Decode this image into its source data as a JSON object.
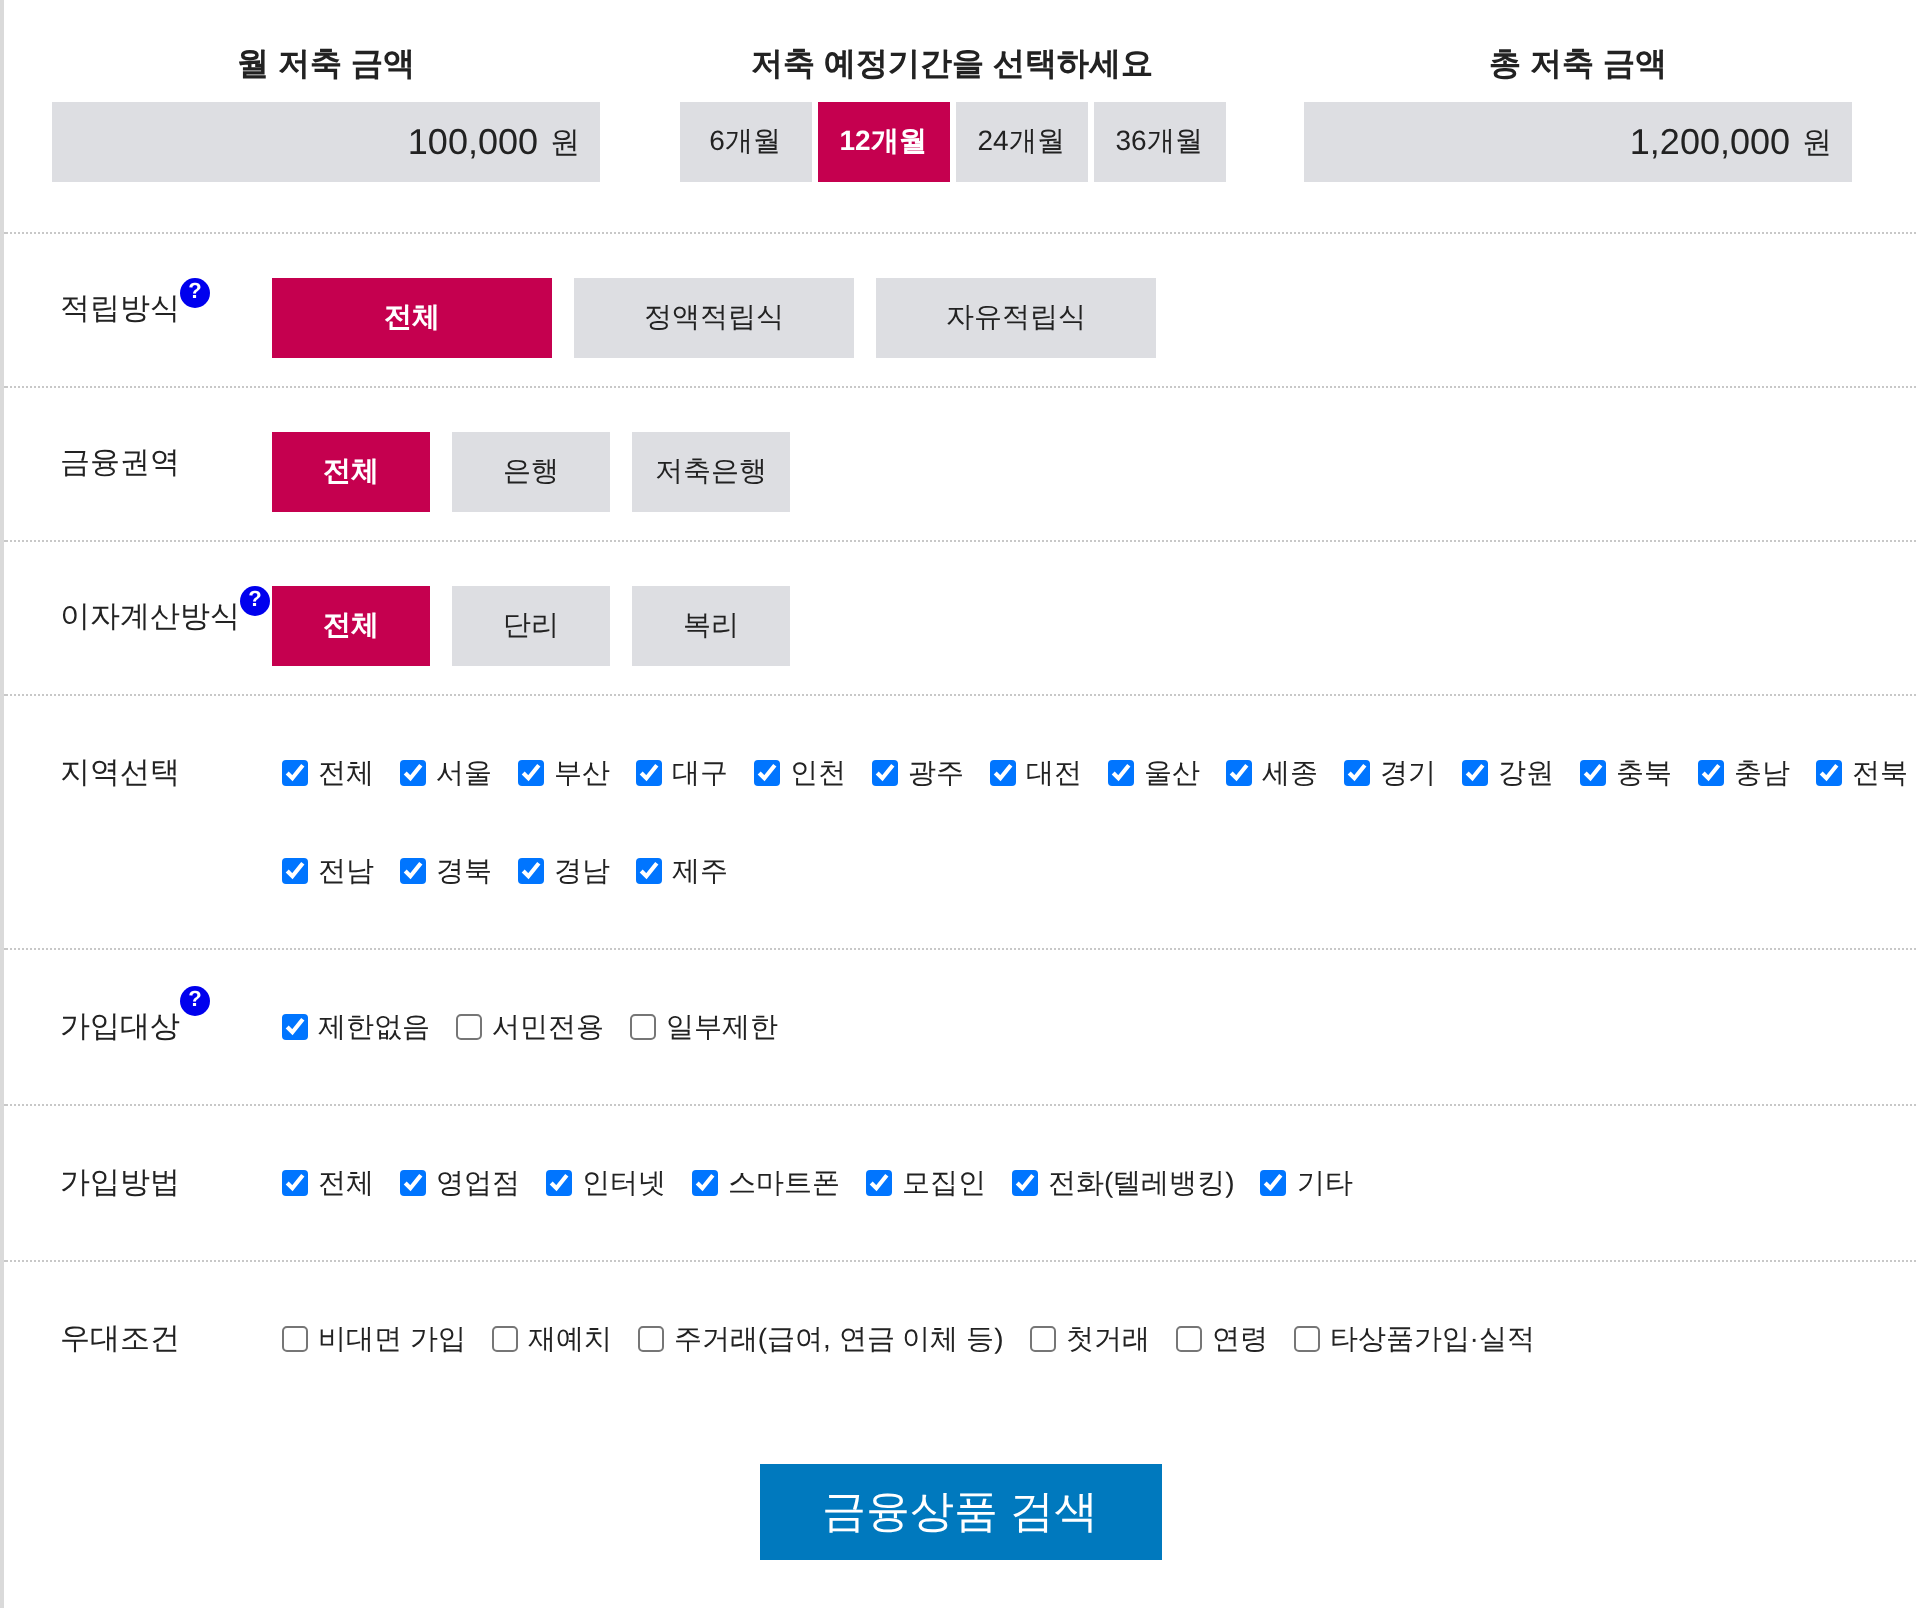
{
  "savings": {
    "monthly": {
      "label": "월 저축 금액",
      "value": "100,000",
      "unit": "원"
    },
    "period": {
      "label": "저축 예정기간을 선택하세요",
      "options": [
        {
          "label": "6개월",
          "selected": false
        },
        {
          "label": "12개월",
          "selected": true
        },
        {
          "label": "24개월",
          "selected": false
        },
        {
          "label": "36개월",
          "selected": false
        }
      ]
    },
    "total": {
      "label": "총 저축 금액",
      "value": "1,200,000",
      "unit": "원"
    }
  },
  "filters": [
    {
      "kind": "wide_buttons",
      "label": "적립방식",
      "help": "?",
      "options": [
        {
          "label": "전체",
          "selected": true
        },
        {
          "label": "정액적립식",
          "selected": false
        },
        {
          "label": "자유적립식",
          "selected": false
        }
      ]
    },
    {
      "kind": "buttons",
      "label": "금융권역",
      "options": [
        {
          "label": "전체",
          "selected": true
        },
        {
          "label": "은행",
          "selected": false
        },
        {
          "label": "저축은행",
          "selected": false
        }
      ]
    },
    {
      "kind": "buttons",
      "label": "이자계산방식",
      "help": "?",
      "options": [
        {
          "label": "전체",
          "selected": true
        },
        {
          "label": "단리",
          "selected": false
        },
        {
          "label": "복리",
          "selected": false
        }
      ]
    },
    {
      "kind": "checkboxes",
      "label": "지역선택",
      "options": [
        {
          "label": "전체",
          "checked": true
        },
        {
          "label": "서울",
          "checked": true
        },
        {
          "label": "부산",
          "checked": true
        },
        {
          "label": "대구",
          "checked": true
        },
        {
          "label": "인천",
          "checked": true
        },
        {
          "label": "광주",
          "checked": true
        },
        {
          "label": "대전",
          "checked": true
        },
        {
          "label": "울산",
          "checked": true
        },
        {
          "label": "세종",
          "checked": true
        },
        {
          "label": "경기",
          "checked": true
        },
        {
          "label": "강원",
          "checked": true
        },
        {
          "label": "충북",
          "checked": true
        },
        {
          "label": "충남",
          "checked": true
        },
        {
          "label": "전북",
          "checked": true
        },
        {
          "label": "전남",
          "checked": true
        },
        {
          "label": "경북",
          "checked": true
        },
        {
          "label": "경남",
          "checked": true
        },
        {
          "label": "제주",
          "checked": true
        }
      ]
    },
    {
      "kind": "checkboxes",
      "label": "가입대상",
      "help": "?",
      "options": [
        {
          "label": "제한없음",
          "checked": true
        },
        {
          "label": "서민전용",
          "checked": false
        },
        {
          "label": "일부제한",
          "checked": false
        }
      ]
    },
    {
      "kind": "checkboxes",
      "label": "가입방법",
      "options": [
        {
          "label": "전체",
          "checked": true
        },
        {
          "label": "영업점",
          "checked": true
        },
        {
          "label": "인터넷",
          "checked": true
        },
        {
          "label": "스마트폰",
          "checked": true
        },
        {
          "label": "모집인",
          "checked": true
        },
        {
          "label": "전화(텔레뱅킹)",
          "checked": true
        },
        {
          "label": "기타",
          "checked": true
        }
      ]
    },
    {
      "kind": "checkboxes",
      "label": "우대조건",
      "options": [
        {
          "label": "비대면 가입",
          "checked": false
        },
        {
          "label": "재예치",
          "checked": false
        },
        {
          "label": "주거래(급여, 연금 이체 등)",
          "checked": false
        },
        {
          "label": "첫거래",
          "checked": false
        },
        {
          "label": "연령",
          "checked": false
        },
        {
          "label": "타상품가입·실적",
          "checked": false
        }
      ]
    }
  ],
  "search_button": "금융상품 검색"
}
